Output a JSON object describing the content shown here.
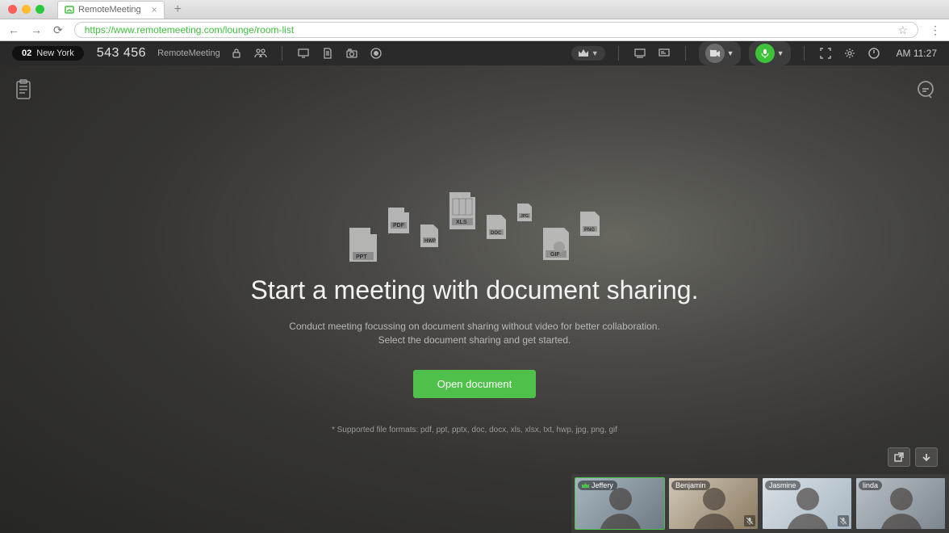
{
  "browser": {
    "tab_title": "RemoteMeeting",
    "url": "https://www.remotemeeting.com/lounge/room-list"
  },
  "topbar": {
    "room_count": "02",
    "location": "New York",
    "room_id": "543 456",
    "room_name": "RemoteMeeting",
    "time": "AM 11:27"
  },
  "main": {
    "title": "Start a meeting with document sharing.",
    "sub1": "Conduct meeting focussing on document sharing without video for better collaboration.",
    "sub2": "Select the document sharing and get started.",
    "button": "Open document",
    "formats": "* Supported file formats: pdf, ppt, pptx, doc, docx, xls, xlsx, txt, hwp, jpg, png, gif"
  },
  "participants": [
    {
      "name": "Jeffery",
      "host": true,
      "muted": false,
      "bg": "linear-gradient(135deg,#a6b5bf,#6e7a83)"
    },
    {
      "name": "Benjamin",
      "host": false,
      "muted": true,
      "bg": "linear-gradient(135deg,#d1c7b8,#8a7a60)"
    },
    {
      "name": "Jasmine",
      "host": false,
      "muted": true,
      "bg": "linear-gradient(135deg,#d9e0e6,#a7b6c2)"
    },
    {
      "name": "linda",
      "host": false,
      "muted": false,
      "bg": "linear-gradient(135deg,#b9c0c7,#7d868e)"
    }
  ]
}
